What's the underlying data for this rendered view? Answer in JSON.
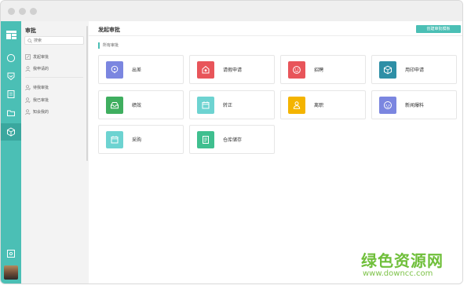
{
  "sidebar": {
    "title": "审批",
    "search_placeholder": "搜索",
    "items": [
      {
        "label": "发起审批",
        "icon": "doc-edit-icon"
      },
      {
        "label": "我申请的",
        "icon": "user-icon"
      },
      {
        "label": "待我审批",
        "icon": "user-pending-icon"
      },
      {
        "label": "我已审批",
        "icon": "user-done-icon"
      },
      {
        "label": "知会我的",
        "icon": "user-notify-icon"
      }
    ]
  },
  "main": {
    "title": "发起审批",
    "create_button": "创建审批模板",
    "section_label": "所有审批"
  },
  "cards": [
    {
      "label": "出差",
      "color": "#7b86e0",
      "icon": "location-pin-icon"
    },
    {
      "label": "请假申请",
      "color": "#e8555a",
      "icon": "leave-icon"
    },
    {
      "label": "招聘",
      "color": "#e8555a",
      "icon": "smiley-icon"
    },
    {
      "label": "用印申请",
      "color": "#2e8fa6",
      "icon": "cube-stamp-icon"
    },
    {
      "label": "绩效",
      "color": "#3fae5f",
      "icon": "inbox-icon"
    },
    {
      "label": "转正",
      "color": "#6dd3d1",
      "icon": "calendar-icon"
    },
    {
      "label": "离职",
      "color": "#f4b400",
      "icon": "person-leave-icon"
    },
    {
      "label": "新闻爆料",
      "color": "#7b86e0",
      "icon": "gamepad-icon"
    },
    {
      "label": "采购",
      "color": "#6dd3d1",
      "icon": "calendar-icon"
    },
    {
      "label": "仓库储存",
      "color": "#3fbf8f",
      "icon": "document-icon"
    }
  ],
  "rail": {
    "accent": "#4bbfb5",
    "icons": [
      "grid-icon",
      "chat-bubble-icon",
      "shield-icon",
      "notes-icon",
      "folder-icon",
      "cube-icon",
      "settings-box-icon"
    ]
  },
  "watermark": {
    "text": "绿色资源网",
    "url": "www.downcc.com"
  }
}
